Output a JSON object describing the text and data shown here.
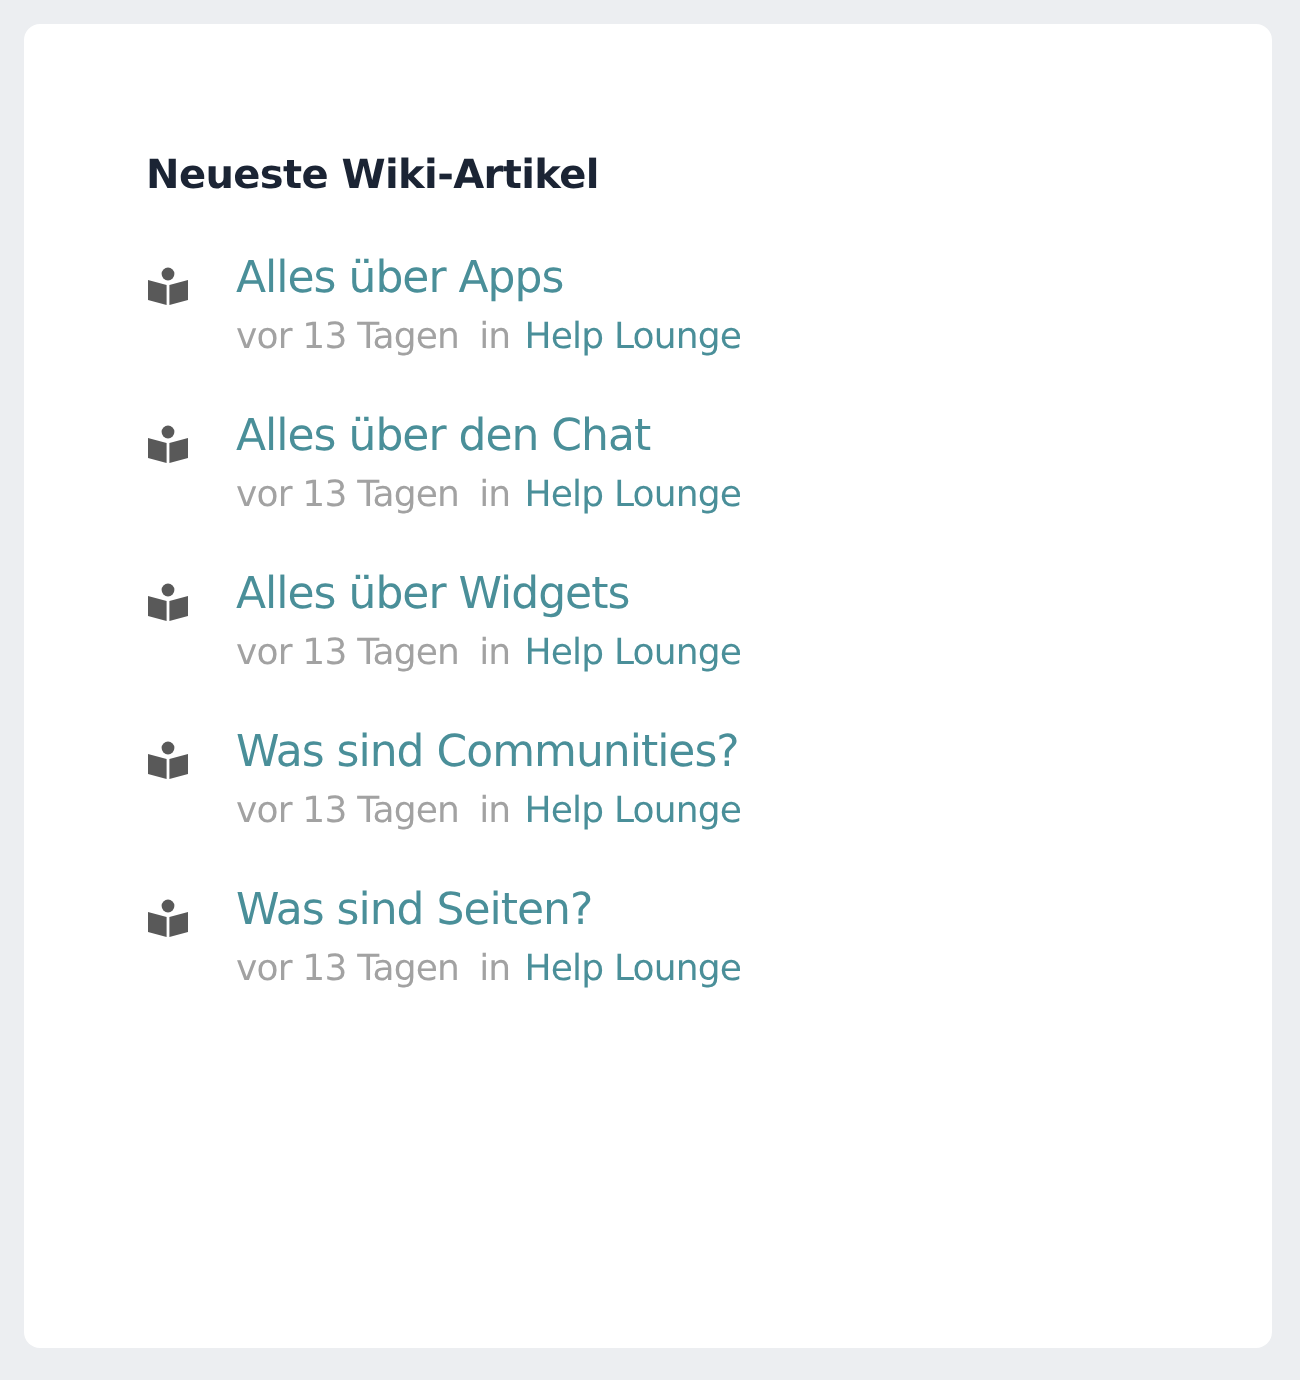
{
  "widget": {
    "title": "Neueste Wiki-Artikel",
    "articles": [
      {
        "title": "Alles über Apps",
        "age": "vor 13 Tagen",
        "preposition": "in",
        "place": "Help Lounge"
      },
      {
        "title": "Alles über den Chat",
        "age": "vor 13 Tagen",
        "preposition": "in",
        "place": "Help Lounge"
      },
      {
        "title": "Alles über Widgets",
        "age": "vor 13 Tagen",
        "preposition": "in",
        "place": "Help Lounge"
      },
      {
        "title": "Was sind Communities?",
        "age": "vor 13 Tagen",
        "preposition": "in",
        "place": "Help Lounge"
      },
      {
        "title": "Was sind Seiten?",
        "age": "vor 13 Tagen",
        "preposition": "in",
        "place": "Help Lounge"
      }
    ]
  }
}
